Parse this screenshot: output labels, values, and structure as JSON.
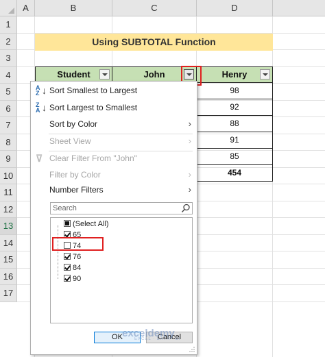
{
  "columns": [
    "A",
    "B",
    "C",
    "D"
  ],
  "rows": [
    "1",
    "2",
    "3",
    "4",
    "5",
    "6",
    "7",
    "8",
    "9",
    "10",
    "11",
    "12",
    "13",
    "14",
    "15",
    "16",
    "17"
  ],
  "title": "Using SUBTOTAL Function",
  "headers": {
    "student": "Student",
    "john": "John",
    "henry": "Henry"
  },
  "henry_values": [
    "98",
    "92",
    "88",
    "91",
    "85"
  ],
  "henry_total": "454",
  "menu": {
    "sort_asc": "Sort Smallest to Largest",
    "sort_desc": "Sort Largest to Smallest",
    "sort_color": "Sort by Color",
    "sheet_view": "Sheet View",
    "clear_filter": "Clear Filter From \"John\"",
    "filter_color": "Filter by Color",
    "number_filters": "Number Filters",
    "search_placeholder": "Search",
    "select_all": "(Select All)",
    "items": [
      {
        "label": "65",
        "checked": true
      },
      {
        "label": "74",
        "checked": false
      },
      {
        "label": "76",
        "checked": true
      },
      {
        "label": "84",
        "checked": true
      },
      {
        "label": "90",
        "checked": true
      }
    ],
    "ok": "OK",
    "cancel": "Cancel"
  },
  "watermark": {
    "name": "exceldemy",
    "tagline": "EXCEL · DATA · BI"
  },
  "colors": {
    "title_fill": "#ffe699",
    "header_fill": "#c6e0b4",
    "highlight": "#e02020"
  }
}
